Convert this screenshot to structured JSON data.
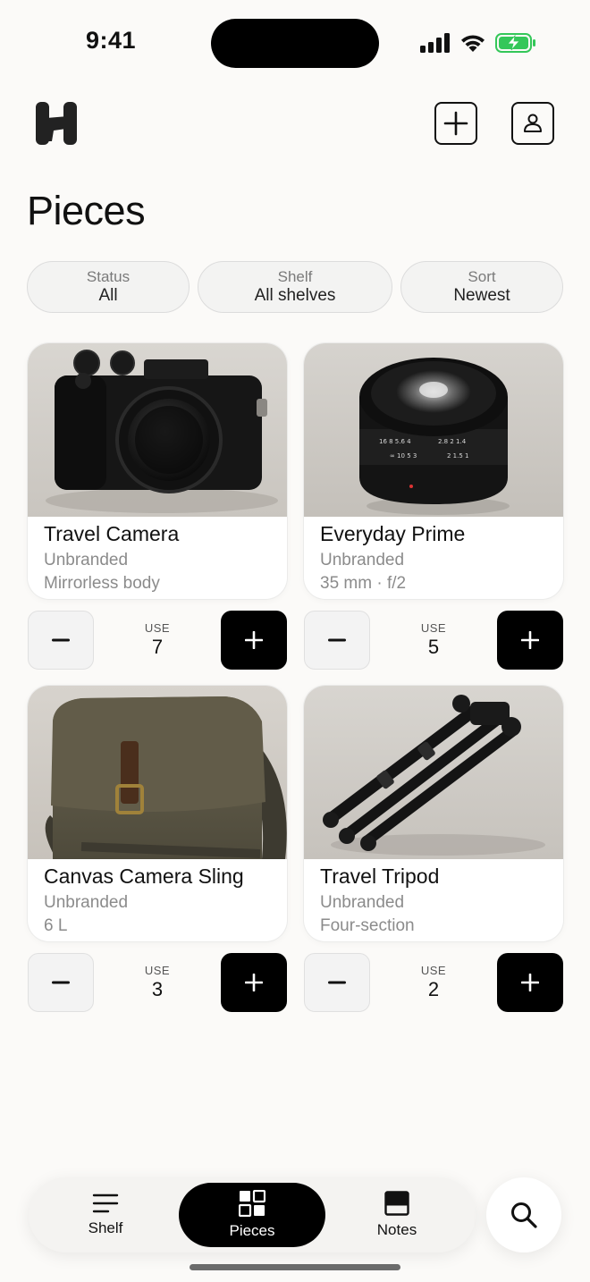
{
  "status_bar": {
    "time": "9:41"
  },
  "header": {
    "title": "Pieces"
  },
  "filters": [
    {
      "label": "Status",
      "value": "All"
    },
    {
      "label": "Shelf",
      "value": "All shelves"
    },
    {
      "label": "Sort",
      "value": "Newest"
    }
  ],
  "pieces": [
    {
      "title": "Travel Camera",
      "brand": "Unbranded",
      "spec": "Mirrorless body",
      "use_label": "USE",
      "use_count": "7"
    },
    {
      "title": "Everyday Prime",
      "brand": "Unbranded",
      "spec": "35 mm · f/2",
      "use_label": "USE",
      "use_count": "5"
    },
    {
      "title": "Canvas Camera Sling",
      "brand": "Unbranded",
      "spec": "6 L",
      "use_label": "USE",
      "use_count": "3"
    },
    {
      "title": "Travel Tripod",
      "brand": "Unbranded",
      "spec": "Four-section",
      "use_label": "USE",
      "use_count": "2"
    }
  ],
  "tabbar": {
    "tabs": [
      {
        "label": "Shelf",
        "icon": "list-icon",
        "selected": false
      },
      {
        "label": "Pieces",
        "icon": "grid-icon",
        "selected": true
      },
      {
        "label": "Notes",
        "icon": "note-icon",
        "selected": false
      }
    ],
    "search_icon": "search-icon"
  },
  "colors": {
    "accent": "#000000",
    "background": "#fbfaf8",
    "battery": "#34c759"
  }
}
